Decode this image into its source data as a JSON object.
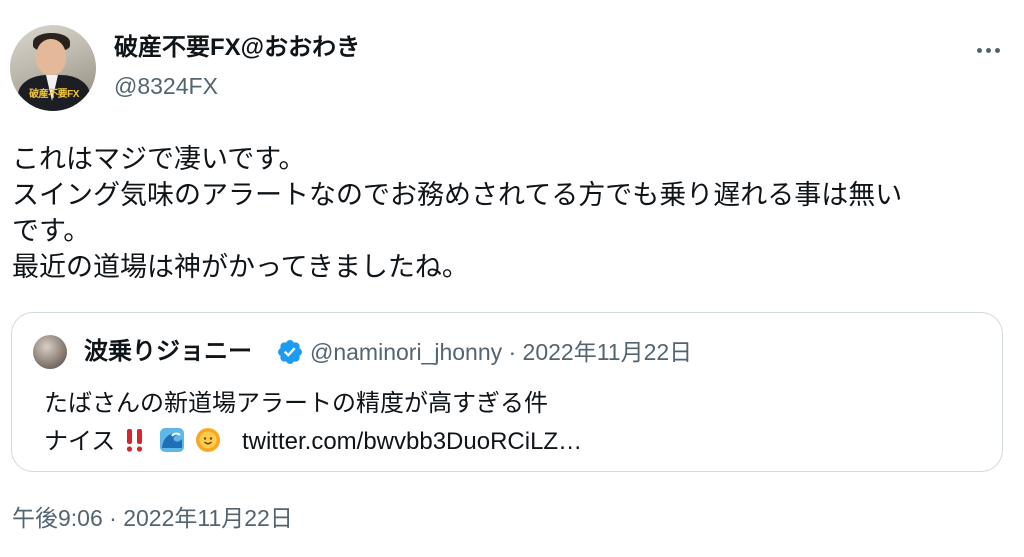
{
  "author": {
    "display_name": "破産不要FX@おおわき",
    "handle": "@8324FX",
    "avatar_caption": "破産不要FX"
  },
  "tweet": {
    "lines": [
      "これはマジで凄いです。",
      "スイング気味のアラートなのでお務めされてる方でも乗り遅れる事は無い",
      "です。",
      "最近の道場は神がかってきましたね。"
    ],
    "timestamp": "午後9:06 · 2022年11月22日"
  },
  "quote": {
    "display_name": "波乗りジョニー",
    "handle_and_date": "@naminori_jhonny · 2022年11月22日",
    "line1": "たばさんの新道場アラートの精度が高すぎる件",
    "line2_prefix": "ナイス",
    "link": "twitter.com/bwvbb3DuoRCiLZ…",
    "emojis": [
      "double-exclamation-icon",
      "wave-icon",
      "sun-icon"
    ]
  },
  "colors": {
    "text": "#0f1419",
    "secondary": "#536471",
    "border": "#cfd9de",
    "verified": "#1d9bf0"
  }
}
